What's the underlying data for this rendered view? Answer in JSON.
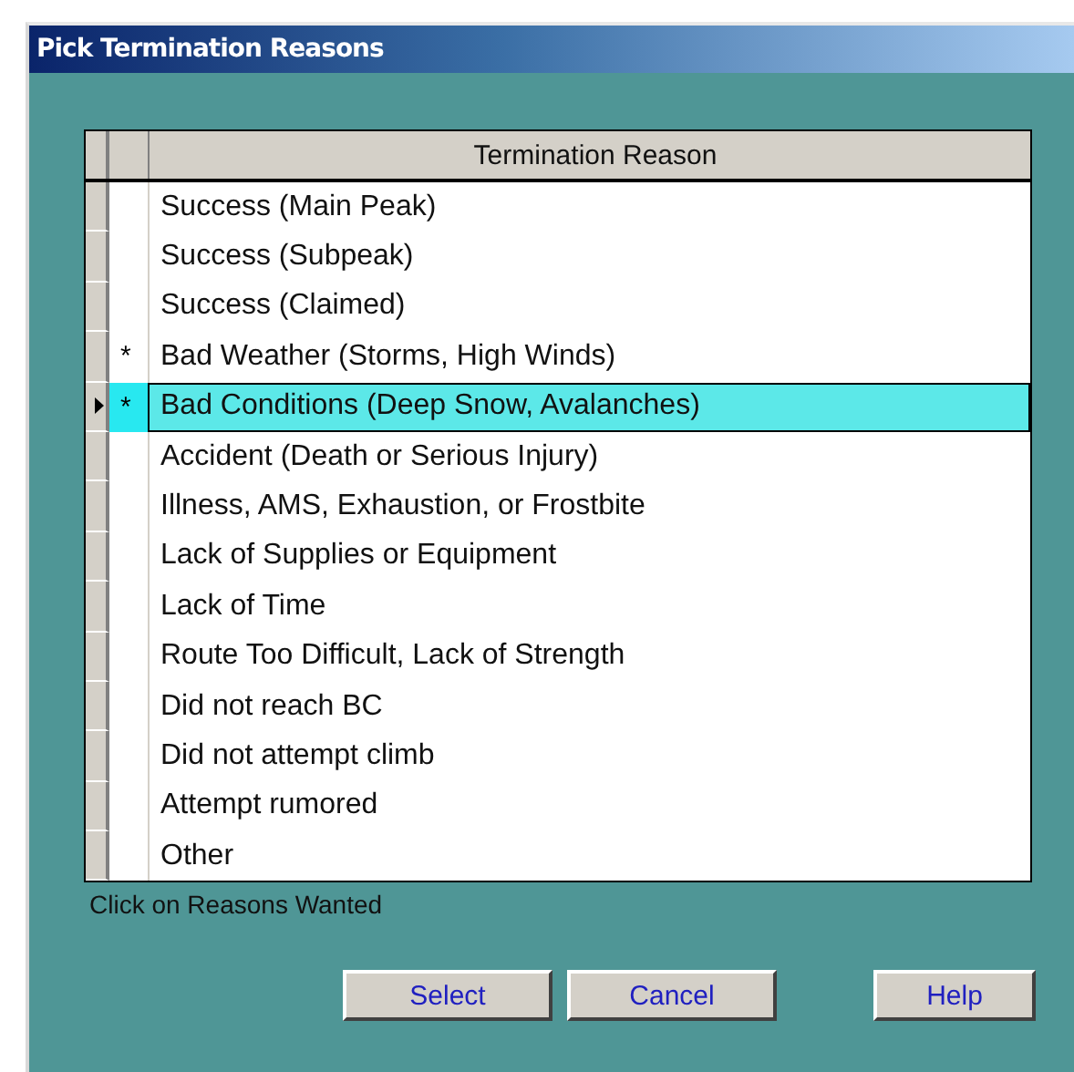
{
  "window": {
    "title": "Pick Termination Reasons"
  },
  "table": {
    "columns": [
      "Termination Reason"
    ],
    "rows": [
      {
        "reason": "Success (Main Peak)",
        "selected": false
      },
      {
        "reason": "Success (Subpeak)",
        "selected": false
      },
      {
        "reason": "Success (Claimed)",
        "selected": false
      },
      {
        "mark": "*",
        "reason": "Bad Weather (Storms, High Winds)",
        "selected": false
      },
      {
        "mark": "*",
        "reason": "Bad Conditions (Deep Snow, Avalanches)",
        "selected": true
      },
      {
        "reason": "Accident (Death or Serious Injury)",
        "selected": false
      },
      {
        "reason": "Illness, AMS, Exhaustion, or Frostbite",
        "selected": false
      },
      {
        "reason": "Lack of Supplies or Equipment",
        "selected": false
      },
      {
        "reason": "Lack of Time",
        "selected": false
      },
      {
        "reason": "Route Too Difficult, Lack of Strength",
        "selected": false
      },
      {
        "reason": "Did not reach BC",
        "selected": false
      },
      {
        "reason": "Did not attempt climb",
        "selected": false
      },
      {
        "reason": "Attempt rumored",
        "selected": false
      },
      {
        "reason": "Other",
        "selected": false
      }
    ]
  },
  "hint": "Click on Reasons Wanted",
  "buttons": [
    "Select",
    "Cancel",
    "Help"
  ]
}
